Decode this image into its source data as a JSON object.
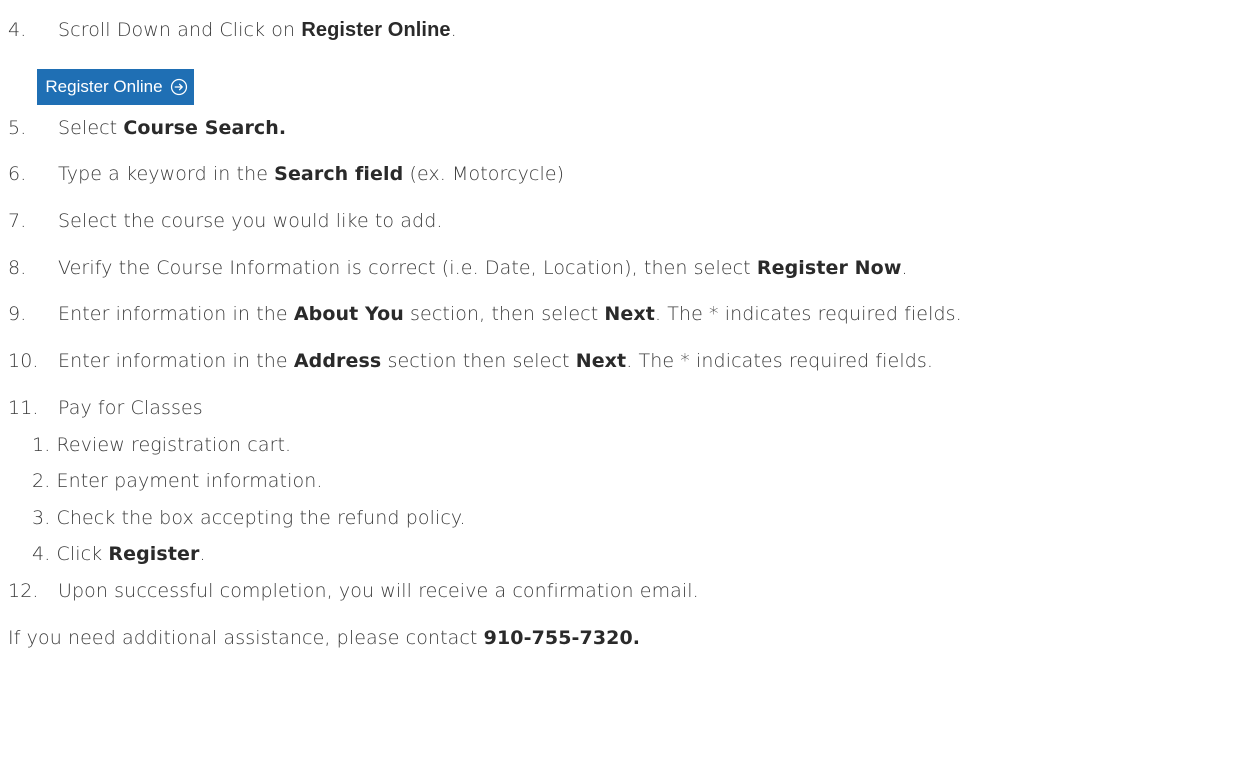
{
  "steps": [
    {
      "num": "4.",
      "pre": "Scroll Down and Click on ",
      "bold": "Register Online",
      "post": "."
    },
    {
      "num": "5.",
      "pre": "Select ",
      "bold": "Course Search.",
      "post": ""
    },
    {
      "num": "6.",
      "pre": "Type a keyword in the ",
      "bold": "Search field",
      "post": " (ex. Motorcycle)"
    },
    {
      "num": "7.",
      "text": "Select the course you would like to add."
    },
    {
      "num": "8.",
      "pre": "Verify the Course Information is correct (i.e. Date, Location), then select ",
      "bold": "Register Now",
      "post": "."
    },
    {
      "num": "9.",
      "pre": "Enter information in the ",
      "bold": "About You",
      "mid": " section, then select ",
      "bold2": "Next",
      "post": ". The * indicates required fields."
    },
    {
      "num": "10.",
      "pre": "Enter information in the ",
      "bold": "Address",
      "mid": " section then select ",
      "bold2": "Next",
      "post": ". The * indicates required fields."
    },
    {
      "num": "11.",
      "text": "Pay for Classes"
    },
    {
      "num": "12.",
      "text": "Upon successful completion, you will receive a confirmation email."
    }
  ],
  "register_button": {
    "label": "Register Online",
    "color": "#1f6fb4",
    "icon": "circle-arrow-right-icon"
  },
  "pay_substeps": [
    {
      "text": "1. Review registration cart."
    },
    {
      "text": "2. Enter payment information."
    },
    {
      "text": "3. Check the box accepting the refund policy."
    },
    {
      "pre": "4. Click ",
      "bold": "Register",
      "post": "."
    }
  ],
  "footer": {
    "pre": "If you need additional assistance, please contact ",
    "phone": "910-755-7320."
  }
}
